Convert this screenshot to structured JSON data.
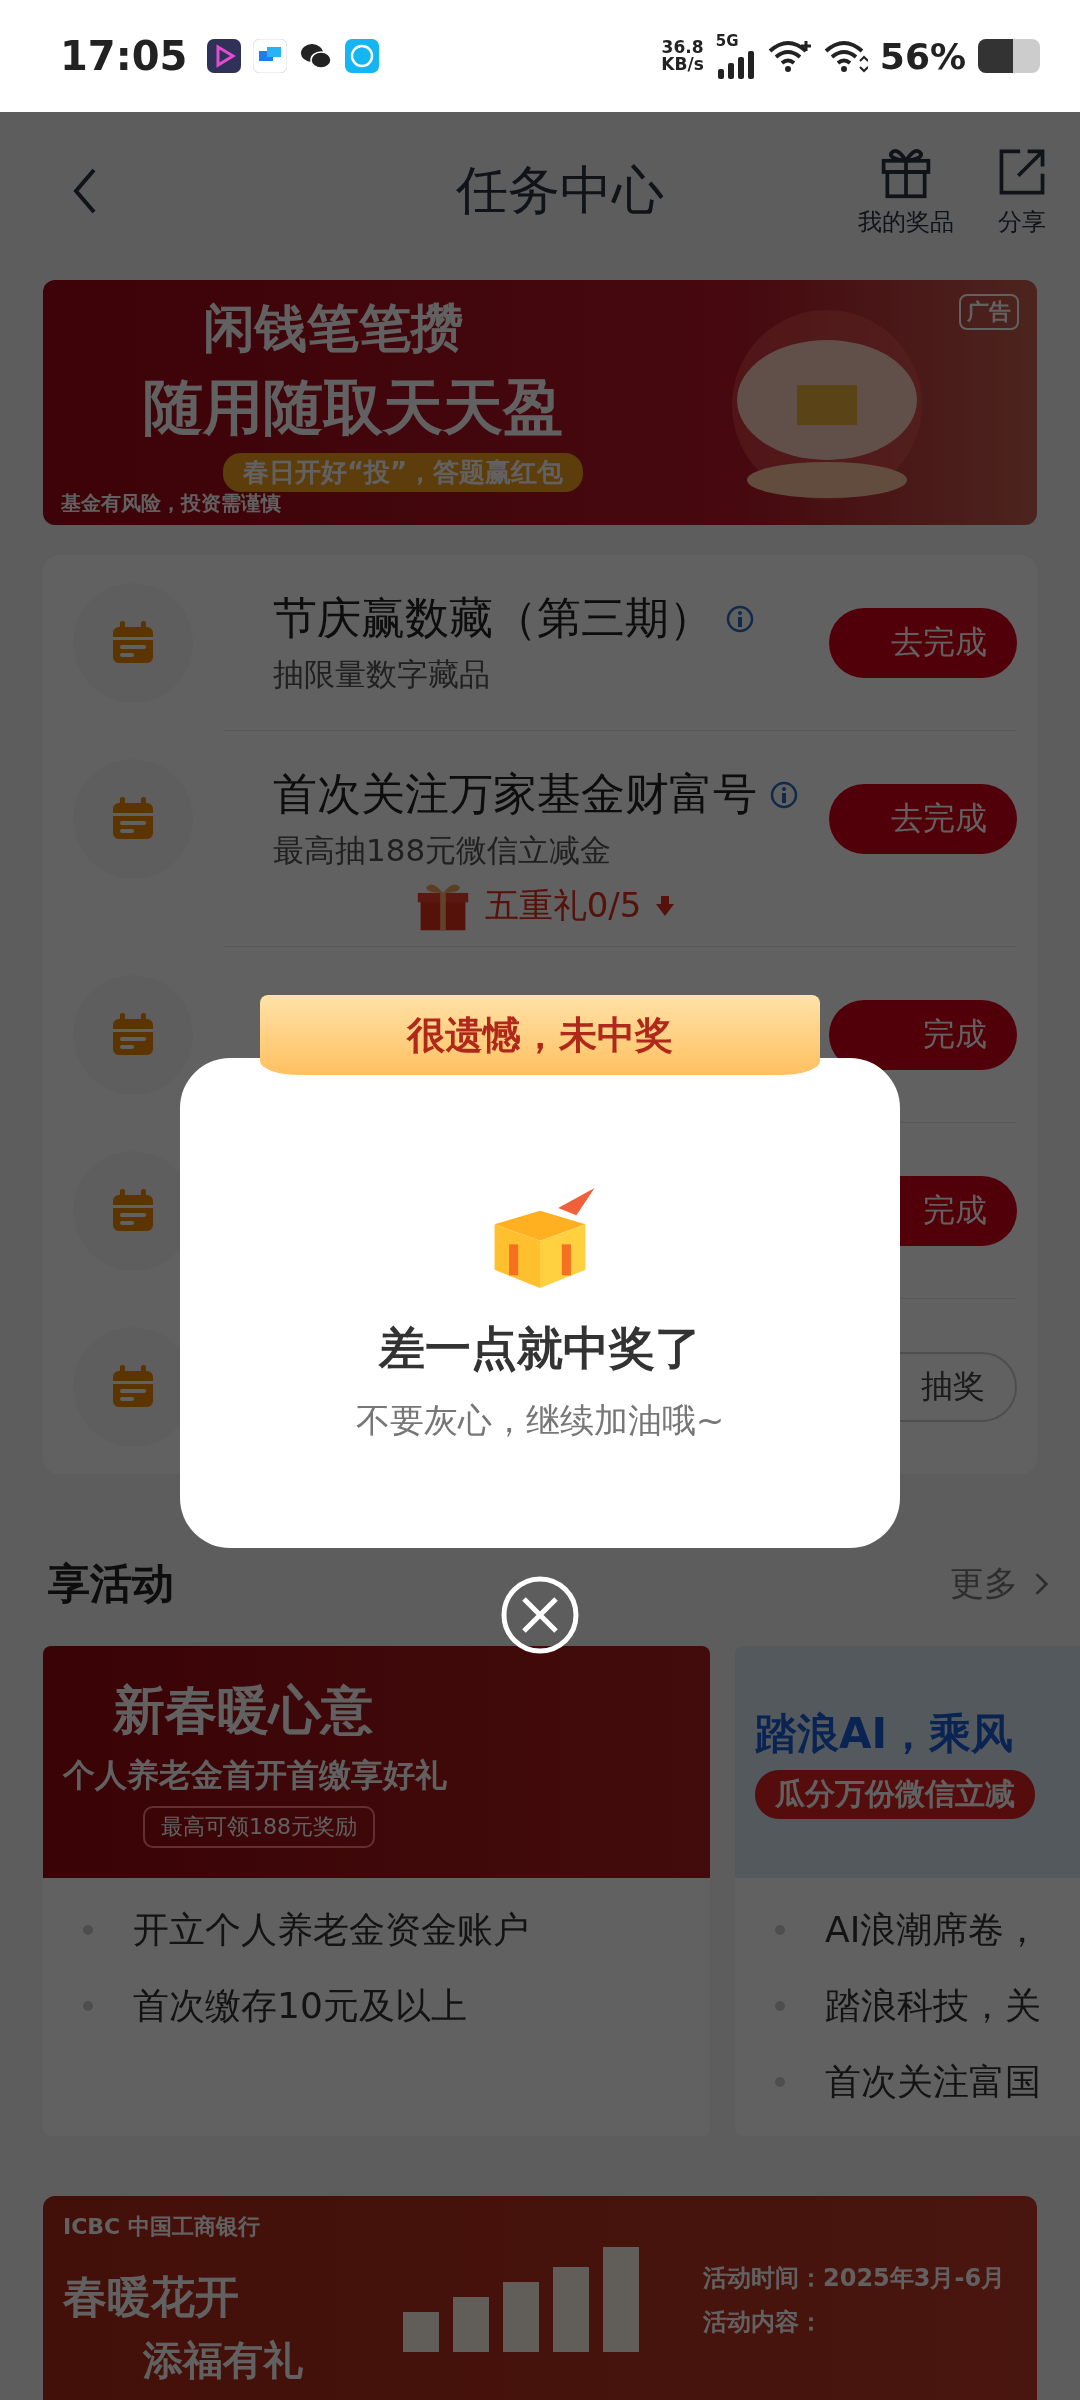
{
  "status_bar": {
    "time": "17:05",
    "speed_value": "36.8",
    "speed_unit": "KB/s",
    "network": "5G",
    "battery": "56%"
  },
  "header": {
    "title": "任务中心",
    "actions": [
      {
        "label": "我的奖品",
        "kind": "gift"
      },
      {
        "label": "分享",
        "kind": "share"
      }
    ]
  },
  "top_banner": {
    "headline_1": "闲钱笔笔攒",
    "headline_2": "随用随取天天盈",
    "slogan": "春日开好“投”，答题赢红包",
    "disclaimer": "基金有风险，投资需谨慎",
    "ad_tag": "广告"
  },
  "tasks": [
    {
      "title": "节庆赢数藏（第三期）",
      "subtitle": "抽限量数字藏品",
      "info": true,
      "button": "去完成",
      "done": false
    },
    {
      "title": "首次关注万家基金财富号",
      "subtitle": "最高抽188元微信立减金",
      "info": true,
      "button": "去完成",
      "done": false
    },
    {
      "button": "完成",
      "done": false
    },
    {
      "button": "完成",
      "done": false
    },
    {
      "button": "抽奖",
      "done": true
    }
  ],
  "five_gifts": {
    "label": "五重礼0/5",
    "expanded": false
  },
  "dialog": {
    "ribbon": "很遗憾，未中奖",
    "title": "差一点就中奖了",
    "message": "不要灰心，继续加油哦~"
  },
  "activities": {
    "title": "享活动",
    "more": "更多",
    "cards": [
      {
        "banner_title": "新春暖心意",
        "banner_subtitle": "个人养老金首开首缴享好礼",
        "banner_tag": "最高可领188元奖励",
        "items": [
          "开立个人养老金资金账户",
          "首次缴存10元及以上"
        ]
      },
      {
        "banner_title": "踏浪AI，乘风",
        "banner_subtitle": "瓜分万份微信立减",
        "items": [
          "AI浪潮席卷，",
          "踏浪科技，关",
          "首次关注富国"
        ]
      }
    ]
  },
  "bottom_banner": {
    "logo": "ICBC 中国工商银行",
    "headline_1": "春暖花开",
    "headline_2": "添福有礼",
    "period": "活动时间：2025年3月-6月",
    "content": "活动内容："
  }
}
